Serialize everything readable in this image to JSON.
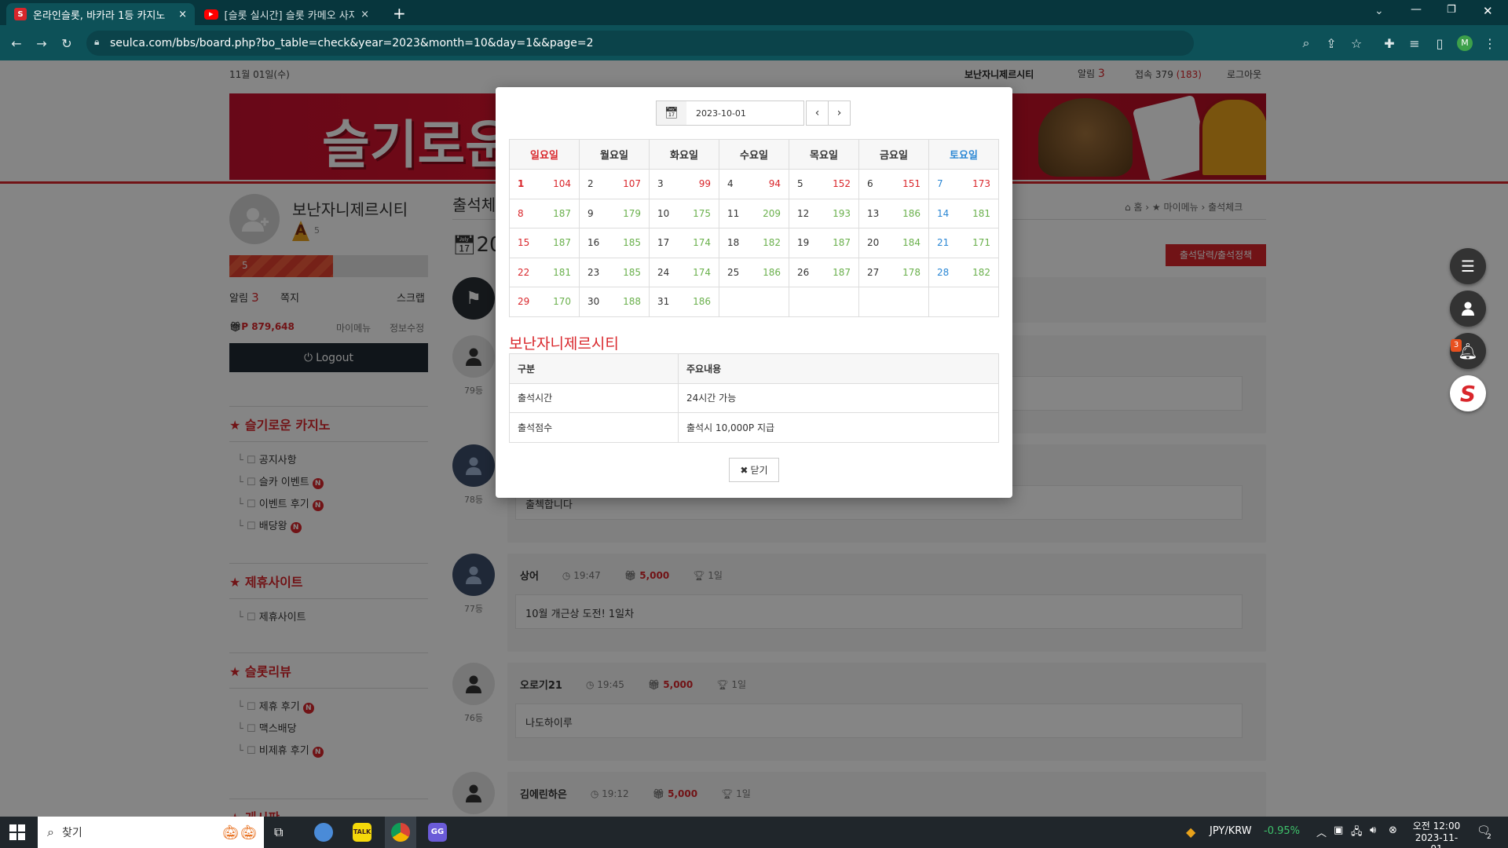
{
  "browser": {
    "tabs": [
      {
        "title": "온라인슬롯, 바카라 1등 카지노",
        "close": "×"
      },
      {
        "title": "[슬롯 실시간] 슬롯 카메오 사자",
        "close": "×"
      }
    ],
    "new_tab": "+",
    "url": "seulca.com/bbs/board.php?bo_table=check&year=2023&month=10&day=1&&page=2",
    "profile_letter": "M"
  },
  "topbar": {
    "date": "11월 01일(수)",
    "username": "보난자니제르시티",
    "alarm_label": "알림",
    "alarm_count": "3",
    "visit_label": "접속",
    "visit_total": "379",
    "visit_today": "(183)",
    "logout": "로그아웃"
  },
  "banner": {
    "text": "슬기로운"
  },
  "profile": {
    "name": "보난자니제르시티",
    "level_badge": "A",
    "level_num": "5",
    "progress_label": "5",
    "progress_percent": 52,
    "alarm_label": "알림",
    "alarm_count": "3",
    "note_label": "쪽지",
    "scrap_label": "스크랩",
    "points": "P 879,648",
    "mymenu": "마이메뉴",
    "edit_info": "정보수정",
    "logout_btn": "Logout"
  },
  "sidebar": {
    "sections": [
      {
        "title": "슬기로운 카지노",
        "items": [
          {
            "label": "공지사항",
            "new": false
          },
          {
            "label": "슬카 이벤트",
            "new": true
          },
          {
            "label": "이벤트 후기",
            "new": true
          },
          {
            "label": "배당왕",
            "new": true
          }
        ]
      },
      {
        "title": "제휴사이트",
        "items": [
          {
            "label": "제휴사이트",
            "new": false
          }
        ]
      },
      {
        "title": "슬롯리뷰",
        "items": [
          {
            "label": "제휴 후기",
            "new": true
          },
          {
            "label": "맥스배당",
            "new": false
          },
          {
            "label": "비제휴 후기",
            "new": true
          }
        ]
      },
      {
        "title": "게시판",
        "items": []
      }
    ],
    "new_badge": "N"
  },
  "main": {
    "title": "출석체크",
    "title_partial": "출석체",
    "year_partial": "20",
    "breadcrumb": [
      "홈",
      "마이메뉴",
      "출석체크"
    ],
    "calendar_btn": "출석달력/출석정책",
    "entries": [
      {
        "rank": "79등",
        "name": "",
        "time": "",
        "points": "",
        "streak": "",
        "message": ""
      },
      {
        "rank": "78등",
        "name": "",
        "time": "",
        "points": "",
        "streak": "",
        "message": "출첵합니다"
      },
      {
        "rank": "77등",
        "name": "상어",
        "time": "19:47",
        "points": "5,000",
        "streak": "1일",
        "message": "10월 개근상 도전! 1일차"
      },
      {
        "rank": "76등",
        "name": "오로기21",
        "time": "19:45",
        "points": "5,000",
        "streak": "1일",
        "message": "나도하이루"
      },
      {
        "rank": "",
        "name": "김에린하은",
        "time": "19:12",
        "points": "5,000",
        "streak": "1일",
        "message": ""
      }
    ]
  },
  "modal": {
    "date_value": "2023-10-01",
    "weekdays": [
      "일요일",
      "월요일",
      "화요일",
      "수요일",
      "목요일",
      "금요일",
      "토요일"
    ],
    "weeks": [
      [
        {
          "d": "1",
          "v": "104"
        },
        {
          "d": "2",
          "v": "107"
        },
        {
          "d": "3",
          "v": "99"
        },
        {
          "d": "4",
          "v": "94"
        },
        {
          "d": "5",
          "v": "152"
        },
        {
          "d": "6",
          "v": "151"
        },
        {
          "d": "7",
          "v": "173"
        }
      ],
      [
        {
          "d": "8",
          "v": "187"
        },
        {
          "d": "9",
          "v": "179"
        },
        {
          "d": "10",
          "v": "175"
        },
        {
          "d": "11",
          "v": "209"
        },
        {
          "d": "12",
          "v": "193"
        },
        {
          "d": "13",
          "v": "186"
        },
        {
          "d": "14",
          "v": "181"
        }
      ],
      [
        {
          "d": "15",
          "v": "187"
        },
        {
          "d": "16",
          "v": "185"
        },
        {
          "d": "17",
          "v": "174"
        },
        {
          "d": "18",
          "v": "182"
        },
        {
          "d": "19",
          "v": "187"
        },
        {
          "d": "20",
          "v": "184"
        },
        {
          "d": "21",
          "v": "171"
        }
      ],
      [
        {
          "d": "22",
          "v": "181"
        },
        {
          "d": "23",
          "v": "185"
        },
        {
          "d": "24",
          "v": "174"
        },
        {
          "d": "25",
          "v": "186"
        },
        {
          "d": "26",
          "v": "187"
        },
        {
          "d": "27",
          "v": "178"
        },
        {
          "d": "28",
          "v": "182"
        }
      ],
      [
        {
          "d": "29",
          "v": "170"
        },
        {
          "d": "30",
          "v": "188"
        },
        {
          "d": "31",
          "v": "186"
        },
        {
          "d": "",
          "v": ""
        },
        {
          "d": "",
          "v": ""
        },
        {
          "d": "",
          "v": ""
        },
        {
          "d": "",
          "v": ""
        }
      ]
    ],
    "user_title": "보난자니제르시티",
    "info_header": [
      "구분",
      "주요내용"
    ],
    "info_rows": [
      [
        "출석시간",
        "24시간 가능"
      ],
      [
        "출석점수",
        "출석시 10,000P 지급"
      ]
    ],
    "close_btn": "닫기"
  },
  "fabs": {
    "bell_count": "3",
    "logo": "S"
  },
  "taskbar": {
    "search": "찾기",
    "currency": "JPY/KRW",
    "currency_change": "-0.95%",
    "clock_time": "오전 12:00",
    "clock_date": "2023-11-01",
    "notif_count": "2"
  },
  "colors": {
    "accent_red": "#d9262b",
    "green": "#6ab04c",
    "blue": "#2b87d4",
    "tab_bg": "#07363d",
    "toolbar_bg": "#0d5158"
  }
}
